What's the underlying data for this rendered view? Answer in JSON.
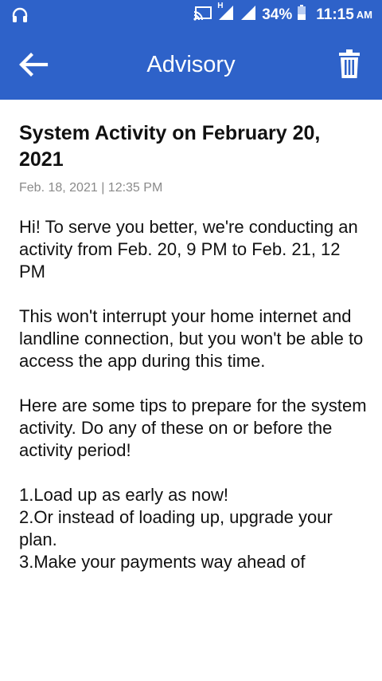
{
  "status_bar": {
    "battery": "34%",
    "time": "11:15",
    "ampm": "AM",
    "network_label": "H"
  },
  "app_bar": {
    "title": "Advisory"
  },
  "advisory": {
    "headline": "System Activity on February 20, 2021",
    "date": "Feb. 18, 2021 | 12:35 PM",
    "paragraphs": [
      "Hi! To serve you better, we're conducting an activity from Feb. 20, 9 PM to Feb. 21, 12 PM",
      "This won't interrupt your home internet and landline connection, but you won't be able to access the app during this time.",
      "Here are some tips to prepare for the system activity. Do any of these on or before the activity period!"
    ],
    "tips": [
      "1.Load up as early as now!",
      "2.Or instead of loading up, upgrade your plan.",
      "3.Make your payments way ahead of"
    ]
  },
  "colors": {
    "primary": "#2e62c9",
    "meta_text": "#8a8a8a"
  }
}
